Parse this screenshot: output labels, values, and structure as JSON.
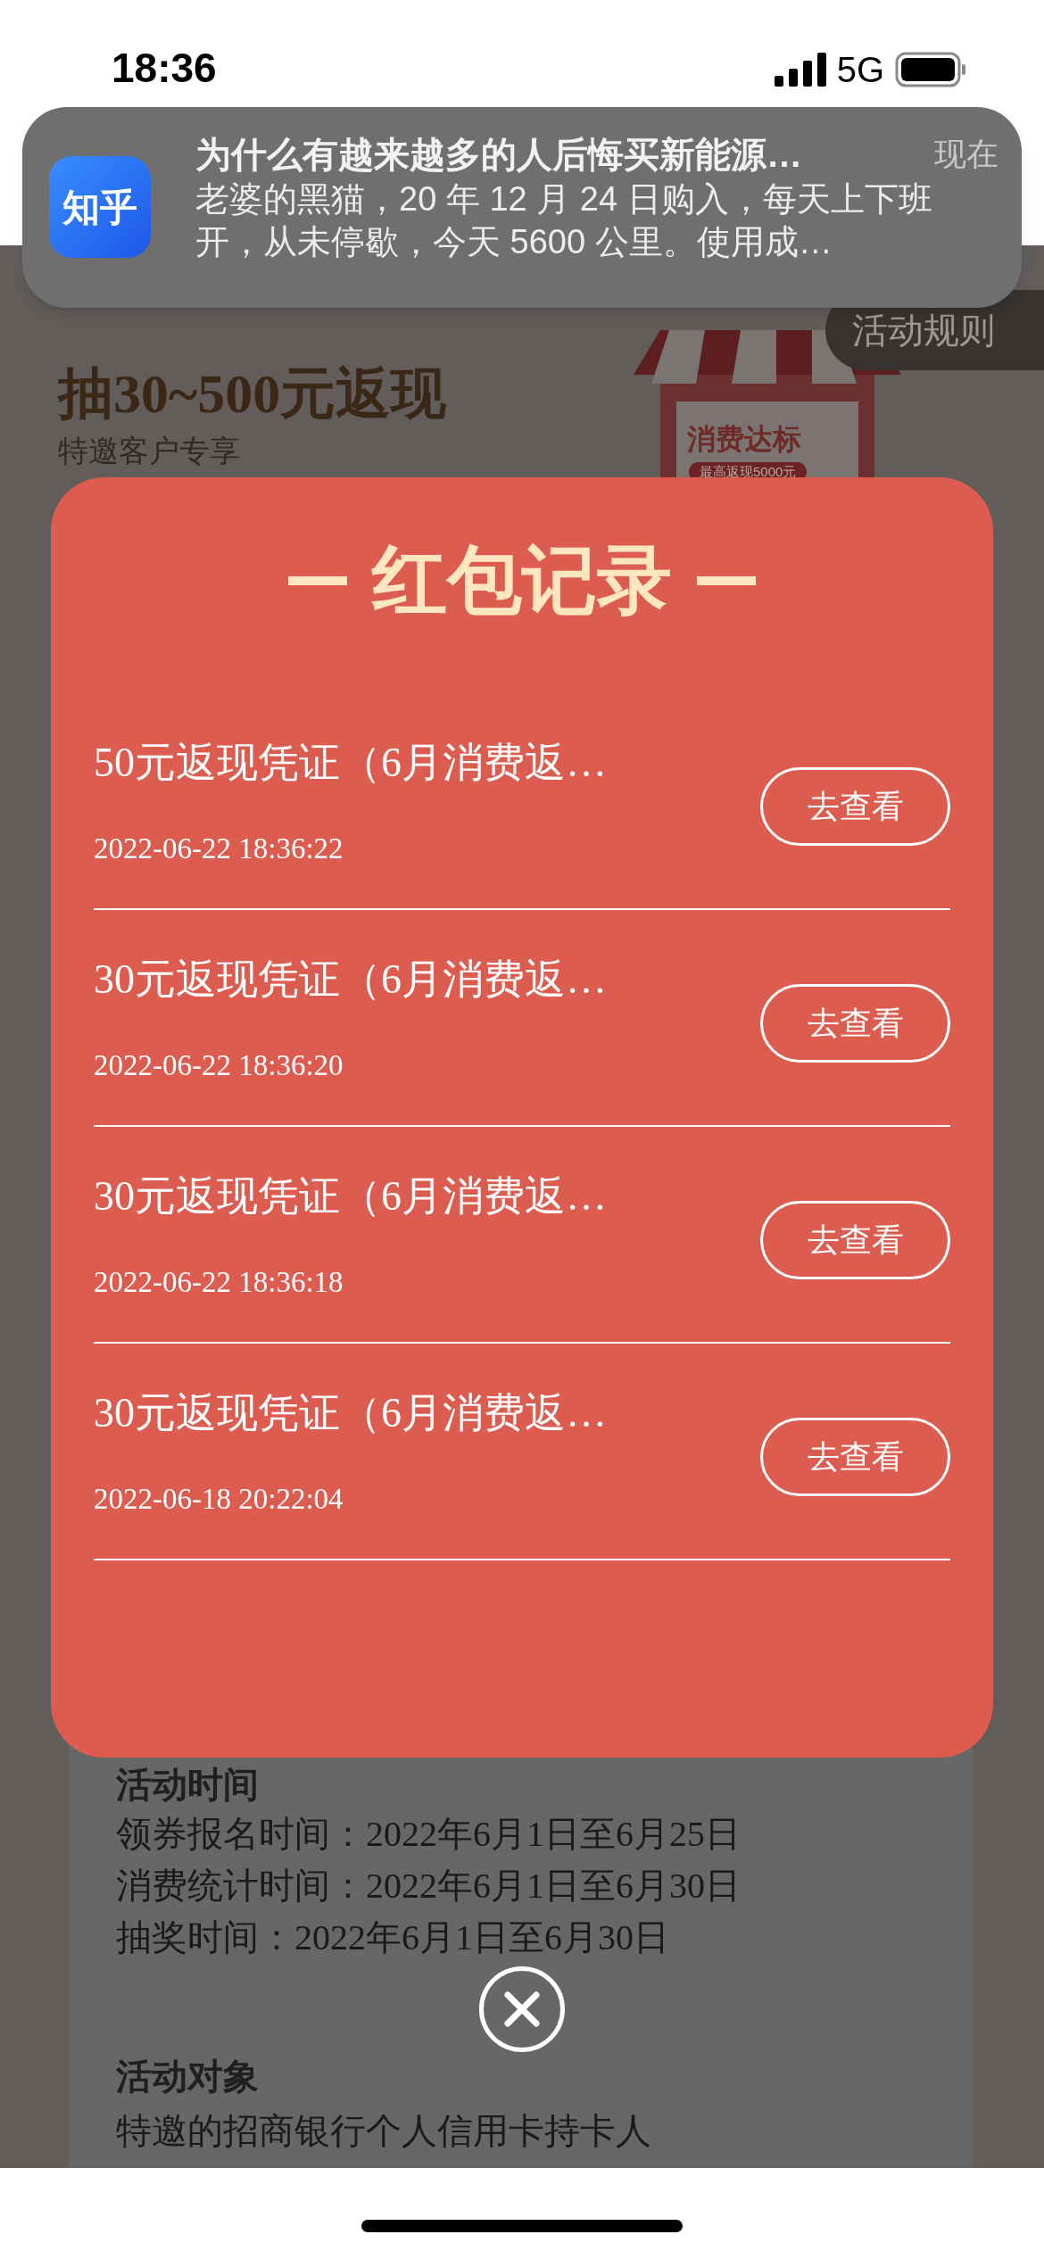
{
  "status_bar": {
    "time": "18:36",
    "network": "5G"
  },
  "notification": {
    "app_icon_text": "知乎",
    "title": "为什么有越来越多的人后悔买新能源…",
    "time": "现在",
    "body": "老婆的黑猫，20 年 12 月 24 日购入，每天上下班开，从未停歇，今天 5600 公里。使用成…"
  },
  "page": {
    "rules_tab": "活动规则",
    "headline": "抽30~500元返现",
    "subheadline": "特邀客户专享",
    "promo": {
      "title": "消费达标",
      "badge": "最高返现5000元"
    },
    "sections": [
      {
        "heading": "活动时间",
        "lines": [
          "领券报名时间：2022年6月1日至6月25日",
          "消费统计时间：2022年6月1日至6月30日",
          "抽奖时间：2022年6月1日至6月30日"
        ]
      },
      {
        "heading": "活动对象",
        "lines": [
          "特邀的招商银行个人信用卡持卡人"
        ]
      }
    ]
  },
  "modal": {
    "title": "红包记录",
    "records": [
      {
        "title": "50元返现凭证（6月消费返…",
        "time": "2022-06-22 18:36:22",
        "button": "去查看"
      },
      {
        "title": "30元返现凭证（6月消费返…",
        "time": "2022-06-22 18:36:20",
        "button": "去查看"
      },
      {
        "title": "30元返现凭证（6月消费返…",
        "time": "2022-06-22 18:36:18",
        "button": "去查看"
      },
      {
        "title": "30元返现凭证（6月消费返…",
        "time": "2022-06-18 20:22:04",
        "button": "去查看"
      }
    ]
  }
}
